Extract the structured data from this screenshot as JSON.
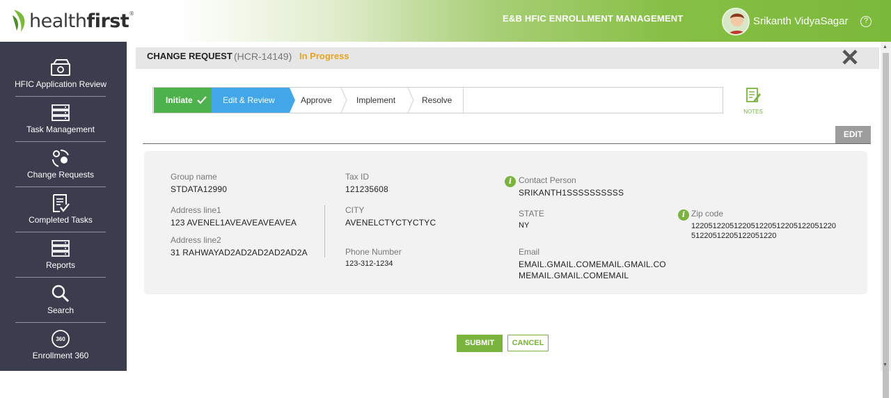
{
  "header": {
    "logo_prefix": "health",
    "logo_bold": "first",
    "logo_tm": "®",
    "app_title": "E&B HFIC ENROLLMENT MANAGEMENT",
    "user_name": "Srikanth VidyaSagar",
    "help_glyph": "?",
    "brand_color": "#7bb93a"
  },
  "sidebar": {
    "items": [
      {
        "label": "HFIC Application Review",
        "icon": "application-review-icon"
      },
      {
        "label": "Task Management",
        "icon": "task-management-icon"
      },
      {
        "label": "Change Requests",
        "icon": "change-requests-icon"
      },
      {
        "label": "Completed Tasks",
        "icon": "completed-tasks-icon"
      },
      {
        "label": "Reports",
        "icon": "reports-icon"
      },
      {
        "label": "Search",
        "icon": "search-icon"
      },
      {
        "label": "Enrollment 360",
        "icon": "enrollment-360-icon",
        "icon_text": "360"
      }
    ]
  },
  "title": {
    "main": "CHANGE REQUEST",
    "id": "(HCR-14149)",
    "status": "In Progress",
    "status_color": "#e8a321"
  },
  "stepper": {
    "steps": [
      "Initiate",
      "Edit & Review",
      "Approve",
      "Implement",
      "Resolve"
    ],
    "completed": "Initiate",
    "active": "Edit & Review"
  },
  "notes": {
    "label": "NOTES"
  },
  "edit_label": "EDIT",
  "form": {
    "group_name": {
      "label": "Group name",
      "value": "STDATA12990"
    },
    "address1": {
      "label": "Address line1",
      "value": "123 AVENEL1AVEAVEAVEAVEA"
    },
    "address2": {
      "label": "Address line2",
      "value": "31 RAHWAYAD2AD2AD2AD2AD2A"
    },
    "tax_id": {
      "label": "Tax ID",
      "value": "121235608"
    },
    "city": {
      "label": "CITY",
      "value": "AVENELCTYCTYCTYC"
    },
    "phone": {
      "label": "Phone Number",
      "value": "123-312-1234"
    },
    "contact": {
      "label": "Contact Person",
      "value": "SRIKANTH1SSSSSSSSSS"
    },
    "state": {
      "label": "STATE",
      "value": "NY"
    },
    "email": {
      "label": "Email",
      "value_line1": "EMAIL.GMAIL.COMEMAIL.GMAIL.CO",
      "value_line2": "MEMAIL.GMAIL.COMEMAIL"
    },
    "zip": {
      "label": "Zip code",
      "value_line1": "1220512205122051220512205122051220",
      "value_line2": "51220512205122051220"
    }
  },
  "actions": {
    "submit": "SUBMIT",
    "cancel": "CANCEL"
  }
}
